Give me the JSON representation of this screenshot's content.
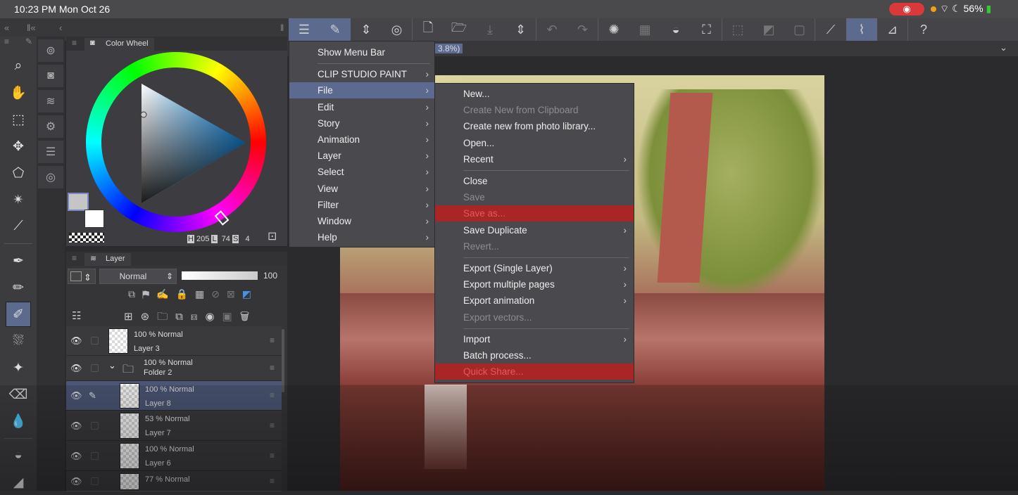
{
  "status": {
    "time": "10:23 PM   Mon Oct 26",
    "battery": "56%",
    "record_icon": "record-icon",
    "wifi_icon": "wifi-icon",
    "moon_icon": "moon-icon"
  },
  "colors": {
    "accent": "#5c6a8f",
    "highlight_red": "#a82626",
    "panel": "#3d3c40"
  },
  "canvas": {
    "zoom_fragment": "3.8%)"
  },
  "toolbar": [
    {
      "icon": "menu-icon",
      "g": "☰",
      "state": "on"
    },
    {
      "icon": "modify-tool-icon",
      "g": "✎",
      "state": "on"
    },
    {
      "icon": "updown-icon",
      "g": "⇕",
      "state": ""
    },
    {
      "icon": "spiral-icon",
      "g": "◎",
      "state": "sep"
    },
    {
      "icon": "new-file-icon",
      "g": "🗋",
      "state": ""
    },
    {
      "icon": "open-folder-icon",
      "g": "🗁",
      "state": ""
    },
    {
      "icon": "save-icon",
      "g": "⤓",
      "state": "dim"
    },
    {
      "icon": "updown-icon",
      "g": "⇕",
      "state": "sep"
    },
    {
      "icon": "undo-icon",
      "g": "↶",
      "state": "dim"
    },
    {
      "icon": "redo-icon",
      "g": "↷",
      "state": "dim sep"
    },
    {
      "icon": "loading-icon",
      "g": "✺",
      "state": ""
    },
    {
      "icon": "clear-icon",
      "g": "▦",
      "state": "dim"
    },
    {
      "icon": "fill-icon",
      "g": "◒",
      "state": ""
    },
    {
      "icon": "transform-icon",
      "g": "⛶",
      "state": "sep"
    },
    {
      "icon": "deselect-icon",
      "g": "⬚",
      "state": "dim"
    },
    {
      "icon": "invert-selection-icon",
      "g": "◩",
      "state": "dim"
    },
    {
      "icon": "selection-border-icon",
      "g": "▢",
      "state": "dim sep"
    },
    {
      "icon": "ruler-icon",
      "g": "⟋",
      "state": ""
    },
    {
      "icon": "brush-icon",
      "g": "⌇",
      "state": "on"
    },
    {
      "icon": "ruler-edit-icon",
      "g": "⊿",
      "state": "sep"
    },
    {
      "icon": "help-icon",
      "g": "?",
      "state": ""
    }
  ],
  "tools": [
    {
      "icon": "zoom-icon",
      "g": "⌕"
    },
    {
      "icon": "hand-icon",
      "g": "✋"
    },
    {
      "icon": "object-select-icon",
      "g": "⬚"
    },
    {
      "icon": "move-icon",
      "g": "✥"
    },
    {
      "icon": "lasso-icon",
      "g": "⬠"
    },
    {
      "icon": "magic-wand-icon",
      "g": "✴"
    },
    {
      "icon": "eyedropper-icon",
      "g": "⟋",
      "gap": true
    },
    {
      "icon": "pen-icon",
      "g": "✒"
    },
    {
      "icon": "pencil-icon",
      "g": "✏"
    },
    {
      "icon": "brush-icon",
      "g": "✐",
      "on": true
    },
    {
      "icon": "airbrush-icon",
      "g": "⛆"
    },
    {
      "icon": "decoration-icon",
      "g": "✦"
    },
    {
      "icon": "eraser-icon",
      "g": "⌫"
    },
    {
      "icon": "blend-icon",
      "g": "💧",
      "gap": true
    },
    {
      "icon": "fill-icon",
      "g": "◒"
    },
    {
      "icon": "gradient-icon",
      "g": "◢"
    }
  ],
  "subtools": [
    {
      "icon": "navigator-icon",
      "g": "⊚"
    },
    {
      "icon": "color-icon",
      "g": "◙"
    },
    {
      "icon": "layers-icon",
      "g": "≋"
    },
    {
      "icon": "layer-property-icon",
      "g": "⚙"
    },
    {
      "icon": "layer-search-icon",
      "g": "☰"
    },
    {
      "icon": "material-icon",
      "g": "◎"
    }
  ],
  "color_wheel": {
    "tab": "Color Wheel",
    "h_label": "H",
    "h": "205",
    "l_label": "L",
    "l": "74",
    "s_label": "S",
    "s": "4"
  },
  "layer_panel": {
    "tab": "Layer",
    "blend_mode": "Normal",
    "opacity": "100",
    "layers": [
      {
        "info": "100 %  Normal",
        "name": "Layer 3",
        "type": "layer"
      },
      {
        "info": "100 %  Normal",
        "name": "Folder 2",
        "type": "folder"
      },
      {
        "info": "100 %  Normal",
        "name": "Layer 8",
        "type": "child",
        "selected": true
      },
      {
        "info": "53 %  Normal",
        "name": "Layer 7",
        "type": "child"
      },
      {
        "info": "100 %  Normal",
        "name": "Layer 6",
        "type": "child"
      },
      {
        "info": "77 %  Normal",
        "name": "",
        "type": "child"
      }
    ]
  },
  "main_menu": [
    {
      "label": "Show Menu Bar",
      "sub": false
    },
    {
      "sep": true
    },
    {
      "label": "CLIP STUDIO PAINT",
      "sub": true
    },
    {
      "label": "File",
      "sub": true,
      "active": true
    },
    {
      "label": "Edit",
      "sub": true
    },
    {
      "label": "Story",
      "sub": true
    },
    {
      "label": "Animation",
      "sub": true
    },
    {
      "label": "Layer",
      "sub": true
    },
    {
      "label": "Select",
      "sub": true
    },
    {
      "label": "View",
      "sub": true
    },
    {
      "label": "Filter",
      "sub": true
    },
    {
      "label": "Window",
      "sub": true
    },
    {
      "label": "Help",
      "sub": true
    }
  ],
  "file_menu": [
    {
      "label": "New..."
    },
    {
      "label": "Create New from Clipboard",
      "disabled": true
    },
    {
      "label": "Create new from photo library..."
    },
    {
      "label": "Open..."
    },
    {
      "label": "Recent",
      "sub": true
    },
    {
      "sep": true
    },
    {
      "label": "Close"
    },
    {
      "label": "Save",
      "disabled": true
    },
    {
      "label": "Save as...",
      "highlight": true
    },
    {
      "label": "Save Duplicate",
      "sub": true
    },
    {
      "label": "Revert...",
      "disabled": true
    },
    {
      "sep": true
    },
    {
      "label": "Export (Single Layer)",
      "sub": true
    },
    {
      "label": "Export multiple pages",
      "sub": true
    },
    {
      "label": "Export animation",
      "sub": true
    },
    {
      "label": "Export vectors...",
      "disabled": true
    },
    {
      "sep": true
    },
    {
      "label": "Import",
      "sub": true
    },
    {
      "label": "Batch process..."
    },
    {
      "label": "Quick Share...",
      "highlight": true
    }
  ]
}
